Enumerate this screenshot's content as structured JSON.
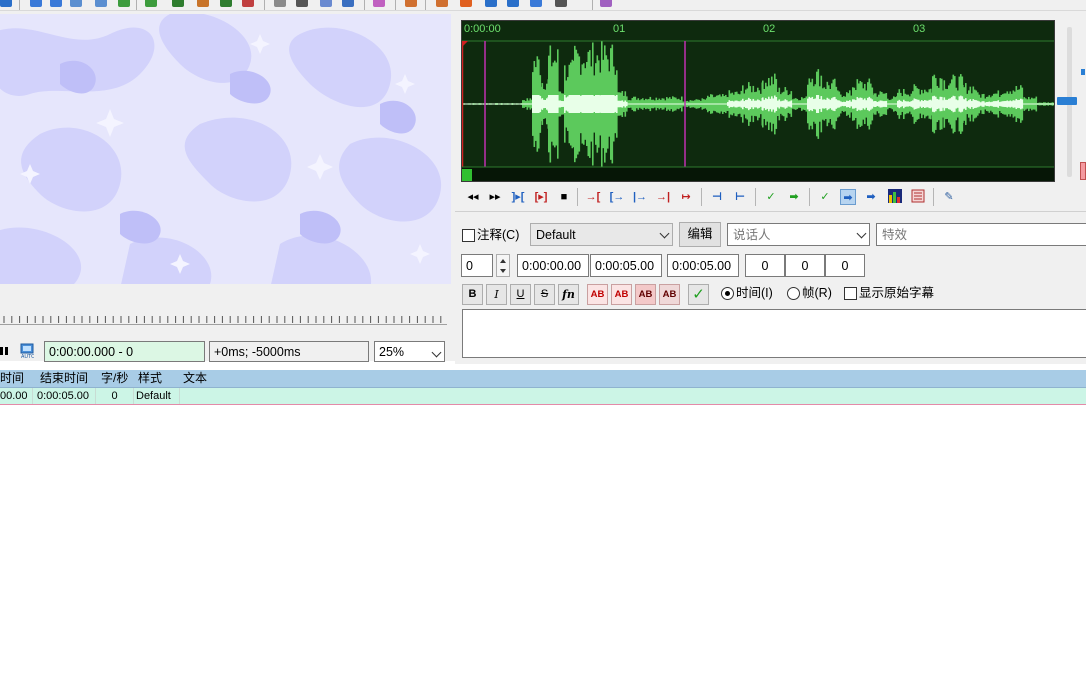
{
  "video": {
    "time_display": "0:00:00.000 - 0",
    "offset_display": "+0ms; -5000ms",
    "zoom_value": "25%"
  },
  "audio": {
    "timeline_labels": [
      "0:00:00",
      "01",
      "02",
      "03"
    ]
  },
  "edit": {
    "comment_label": "注释(C)",
    "comment_checked": false,
    "style_value": "Default",
    "edit_button_label": "编辑",
    "actor_placeholder": "说话人",
    "effect_placeholder": "特效",
    "layer_value": "0",
    "start_time": "0:00:00.00",
    "end_time": "0:00:05.00",
    "duration": "0:00:05.00",
    "margin_left": "0",
    "margin_right": "0",
    "margin_vertical": "0",
    "format_buttons": {
      "bold": "B",
      "italic": "I",
      "underline": "U",
      "strikeout": "S",
      "font": "fn",
      "color1": "AB",
      "color2": "AB",
      "color3": "AB",
      "color4": "AB"
    },
    "time_radio_label": "时间(I)",
    "frame_radio_label": "帧(R)",
    "show_original_label": "显示原始字幕",
    "time_mode_selected": true,
    "show_original_checked": false
  },
  "grid": {
    "headers": [
      "时间",
      "结束时间",
      "字/秒",
      "样式",
      "文本"
    ],
    "rows": [
      {
        "start": "00.00",
        "end": "0:00:05.00",
        "cps": "0",
        "style": "Default",
        "text": ""
      }
    ]
  },
  "colors": {
    "waveform_bg": "#0e2a0e",
    "waveform_fg": "#5cc95c",
    "grid_header": "#a8cce6",
    "grid_row_active": "#ccf5e6",
    "time_field_bg": "#dcf7e4"
  },
  "icons": {
    "toolbar": [
      "arrow-icon",
      "search-icon",
      "zoom-icon",
      "video-icon",
      "audio-icon",
      "timing-icon",
      "shift-icon",
      "style-icon",
      "font-icon",
      "chart-icon",
      "record-icon",
      "notes-icon",
      "tag-icon",
      "translate-icon",
      "edit-icon",
      "ghost-icon",
      "copy-icon",
      "paste-icon",
      "export-icon",
      "clock-icon",
      "spellcheck-icon",
      "check-icon",
      "tools-icon",
      "macro-icon"
    ],
    "audio_toolbar": [
      "prev-line-icon",
      "next-line-icon",
      "play-start-icon",
      "play-selection-icon",
      "stop-icon",
      "play-before-icon",
      "play-after-icon",
      "play-end-before-icon",
      "play-end-after-icon",
      "play-line-icon",
      "snap-start-icon",
      "snap-end-icon",
      "commit-icon",
      "goto-icon",
      "auto-commit-icon",
      "auto-next-icon",
      "auto-scroll-icon",
      "spectrum-icon",
      "karaoke-icon",
      "settings-icon"
    ]
  }
}
